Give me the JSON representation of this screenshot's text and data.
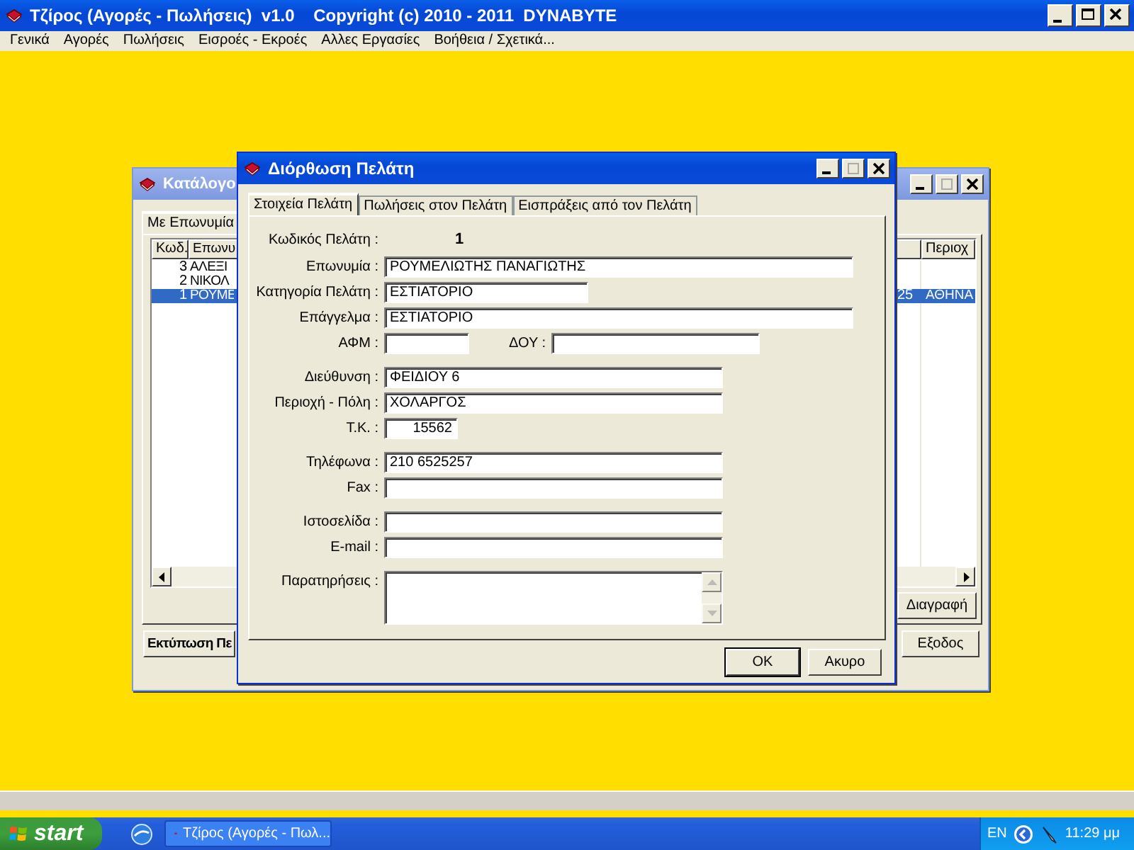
{
  "app": {
    "title": "Τζίρος (Αγορές - Πωλήσεις)  v1.0    Copyright (c) 2010 - 2011  DYNABYTE",
    "menu": [
      "Γενικά",
      "Αγορές",
      "Πωλήσεις",
      "Εισροές - Εκροές",
      "Αλλες Εργασίες",
      "Βοήθεια / Σχετικά..."
    ]
  },
  "catalog_window": {
    "title": "Κατάλογο",
    "active": false,
    "tabs": [
      {
        "label": "Με Επωνυμία",
        "selected": true
      }
    ],
    "columns": {
      "code": "Κωδ.",
      "name": "Επωνυ",
      "area": "Περιοχ"
    },
    "rows": [
      {
        "code": "3",
        "name": "ΑΛΕΞΙ",
        "selected": false
      },
      {
        "code": "2",
        "name": "ΝΙΚΟΛ",
        "selected": false
      },
      {
        "code": "1",
        "name": "ΡΟΥΜΕ",
        "column_3": "25",
        "area": "ΑΘΗΝΑ",
        "selected": true
      }
    ],
    "delete_button": "Διαγραφή",
    "print_label": "Εκτύπωση Πε",
    "exit_button": "Εξοδος"
  },
  "edit_dialog": {
    "title": "Διόρθωση Πελάτη",
    "active": true,
    "tabs": [
      {
        "label": "Στοιχεία Πελάτη",
        "selected": true
      },
      {
        "label": "Πωλήσεις στον Πελάτη",
        "selected": false
      },
      {
        "label": "Εισπράξεις από τον Πελάτη",
        "selected": false
      }
    ],
    "groups": [
      [
        {
          "kind": "static",
          "label": "Κωδικός Πελάτη :",
          "value": "1"
        },
        {
          "kind": "wide",
          "label": "Επωνυμία :",
          "value": "ΡΟΥΜΕΛΙΩΤΗΣ ΠΑΝΑΓΙΩΤΗΣ"
        },
        {
          "kind": "medium",
          "label": "Κατηγορία Πελάτη :",
          "value": "ΕΣΤΙΑΤΟΡΙΟ"
        },
        {
          "kind": "wide",
          "label": "Επάγγελμα :",
          "value": "ΕΣΤΙΑΤΟΡΙΟ"
        },
        {
          "kind": "pair",
          "label": "ΑΦΜ :",
          "second_label": "ΔΟΥ :"
        }
      ],
      [
        {
          "kind": "long",
          "label": "Διεύθυνση :",
          "value": "ΦΕΙΔΙΟΥ 6"
        },
        {
          "kind": "long",
          "label": "Περιοχή - Πόλη :",
          "value": "ΧΟΛΑΡΓΟΣ"
        },
        {
          "kind": "tiny",
          "label": "Τ.Κ. :",
          "value": "15562"
        }
      ],
      [
        {
          "kind": "long",
          "label": "Τηλέφωνα :",
          "value": "210 6525257"
        },
        {
          "kind": "long",
          "label": "Fax :"
        }
      ],
      [
        {
          "kind": "long",
          "label": "Ιστοσελίδα :"
        },
        {
          "kind": "long",
          "label": "E-mail :"
        }
      ],
      [
        {
          "kind": "memo",
          "label": "Παρατηρήσεις :"
        }
      ]
    ],
    "buttons": [
      {
        "label": "OK",
        "default": true
      },
      {
        "label": "Ακυρο",
        "default": false
      }
    ]
  },
  "taskbar": {
    "start": "start",
    "tasks": [
      {
        "label": "Τζίρος (Αγορές - Πωλ...",
        "selected": false
      }
    ],
    "language": "EN",
    "clock": "11:29 μμ"
  }
}
